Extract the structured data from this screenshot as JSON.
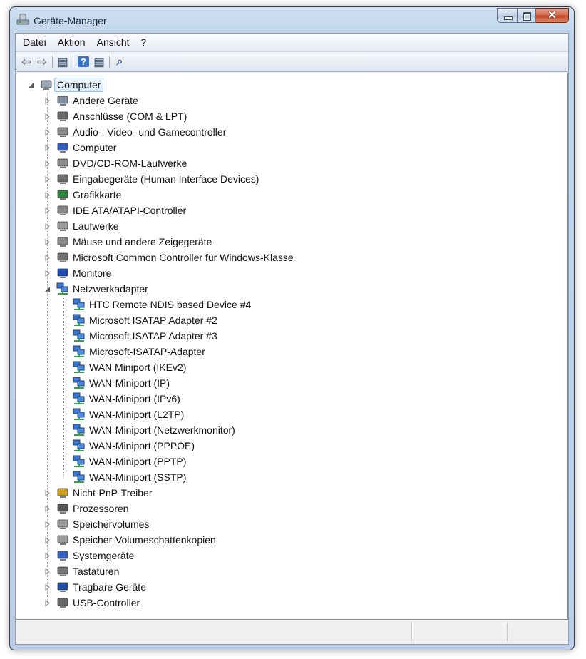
{
  "window": {
    "title": "Geräte-Manager",
    "close_glyph": "✕"
  },
  "menu": [
    "Datei",
    "Aktion",
    "Ansicht",
    "?"
  ],
  "toolbar": [
    {
      "name": "back-icon",
      "glyph": "⇦",
      "color": "#7b8390"
    },
    {
      "name": "forward-icon",
      "glyph": "⇨",
      "color": "#7b8390"
    },
    {
      "sep": true
    },
    {
      "name": "show-hide-console-tree-icon",
      "glyph": "▤",
      "color": "#5b6f86"
    },
    {
      "sep": true
    },
    {
      "name": "help-icon",
      "glyph": "?",
      "color": "#2f5fb3"
    },
    {
      "name": "properties-icon",
      "glyph": "▤",
      "color": "#5b6f86"
    },
    {
      "sep": true
    },
    {
      "name": "scan-hardware-icon",
      "glyph": "⌕",
      "color": "#3e5f8a"
    }
  ],
  "tree": {
    "root": {
      "label": "Computer",
      "icon": "computer-icon"
    },
    "categories": [
      {
        "label": "Andere Geräte",
        "icon": "unknown-device-icon",
        "color": "#7f8ea3"
      },
      {
        "label": "Anschlüsse (COM & LPT)",
        "icon": "port-icon",
        "color": "#6b6b6b"
      },
      {
        "label": "Audio-, Video- und Gamecontroller",
        "icon": "speaker-icon",
        "color": "#8c8c8c"
      },
      {
        "label": "Computer",
        "icon": "computer-icon",
        "color": "#2f62c4"
      },
      {
        "label": "DVD/CD-ROM-Laufwerke",
        "icon": "optical-drive-icon",
        "color": "#8a8a8a"
      },
      {
        "label": "Eingabegeräte (Human Interface Devices)",
        "icon": "hid-icon",
        "color": "#707070"
      },
      {
        "label": "Grafikkarte",
        "icon": "display-adapter-icon",
        "color": "#2a8a3a"
      },
      {
        "label": "IDE ATA/ATAPI-Controller",
        "icon": "ide-controller-icon",
        "color": "#888888"
      },
      {
        "label": "Laufwerke",
        "icon": "disk-drive-icon",
        "color": "#9a9a9a"
      },
      {
        "label": "Mäuse und andere Zeigegeräte",
        "icon": "mouse-icon",
        "color": "#8b8b8b"
      },
      {
        "label": "Microsoft Common Controller für Windows-Klasse",
        "icon": "controller-icon",
        "color": "#707070"
      },
      {
        "label": "Monitore",
        "icon": "monitor-icon",
        "color": "#1d4fb3"
      },
      {
        "label": "Netzwerkadapter",
        "icon": "network-adapter-icon",
        "color": "#2f6fc8",
        "expanded": true,
        "children": [
          "HTC Remote NDIS based Device #4",
          "Microsoft ISATAP Adapter #2",
          "Microsoft ISATAP Adapter #3",
          "Microsoft-ISATAP-Adapter",
          "WAN Miniport (IKEv2)",
          "WAN-Miniport (IP)",
          "WAN-Miniport (IPv6)",
          "WAN-Miniport (L2TP)",
          "WAN-Miniport (Netzwerkmonitor)",
          "WAN-Miniport (PPPOE)",
          "WAN-Miniport (PPTP)",
          "WAN-Miniport (SSTP)"
        ]
      },
      {
        "label": "Nicht-PnP-Treiber",
        "icon": "driver-icon",
        "color": "#d4a017"
      },
      {
        "label": "Prozessoren",
        "icon": "processor-icon",
        "color": "#555555"
      },
      {
        "label": "Speichervolumes",
        "icon": "volume-icon",
        "color": "#9a9a9a"
      },
      {
        "label": "Speicher-Volumeschattenkopien",
        "icon": "shadow-copy-icon",
        "color": "#9a9a9a"
      },
      {
        "label": "Systemgeräte",
        "icon": "system-device-icon",
        "color": "#2f62c4"
      },
      {
        "label": "Tastaturen",
        "icon": "keyboard-icon",
        "color": "#777777"
      },
      {
        "label": "Tragbare Geräte",
        "icon": "portable-device-icon",
        "color": "#1f4fa8"
      },
      {
        "label": "USB-Controller",
        "icon": "usb-icon",
        "color": "#666666"
      }
    ]
  }
}
